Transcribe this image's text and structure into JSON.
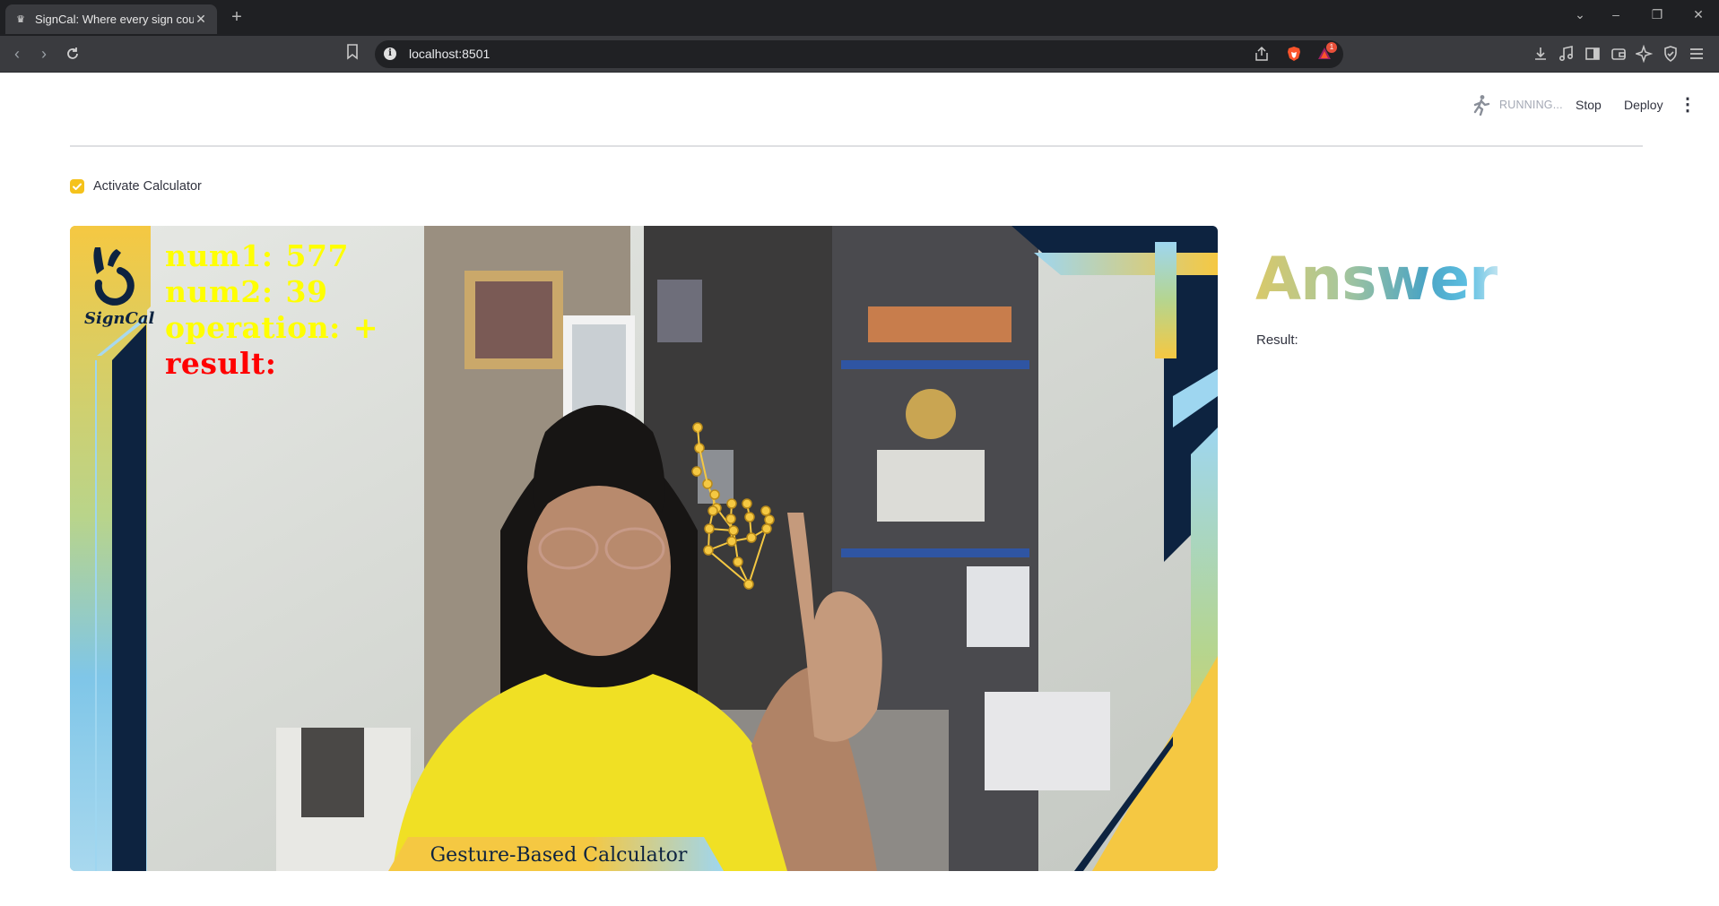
{
  "browser": {
    "tab_title": "SignCal: Where every sign counts",
    "tab_close": "✕",
    "new_tab": "+",
    "url": "localhost:8501",
    "rewards_badge": "1"
  },
  "streamlit": {
    "status": "RUNNING...",
    "stop_label": "Stop",
    "deploy_label": "Deploy",
    "menu_glyph": "⋮"
  },
  "controls": {
    "activate_label": "Activate Calculator",
    "activate_checked": true
  },
  "video": {
    "logo_text": "SignCal",
    "num1_label": "num1:",
    "num1_value": "577",
    "num2_label": "num2:",
    "num2_value": "39",
    "operation_label": "operation:",
    "operation_value": "+",
    "result_label": "result:",
    "banner": "Gesture-Based Calculator",
    "landmark_color": "#f5c842"
  },
  "answer_panel": {
    "heading": "Answer",
    "result_label": "Result:"
  },
  "colors": {
    "accent_yellow": "#f5c21b",
    "frame_navy": "#0d2340",
    "frame_blue": "#7fc6e8"
  }
}
